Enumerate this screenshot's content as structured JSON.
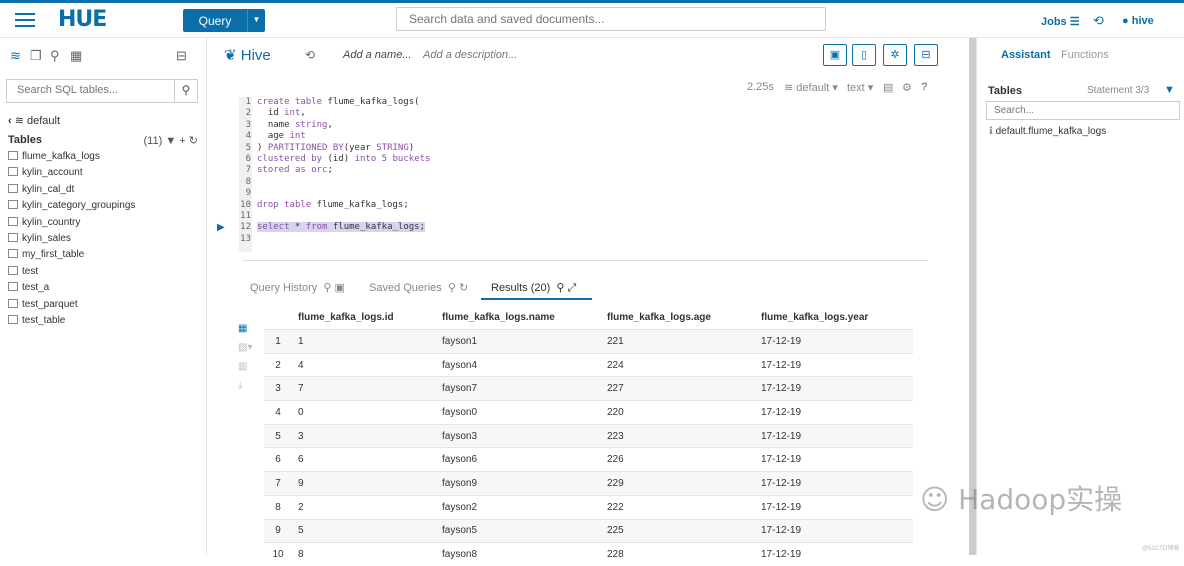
{
  "header": {
    "logo": "HUE",
    "query_button": "Query",
    "search_placeholder": "Search data and saved documents...",
    "jobs": "Jobs",
    "user": "hive"
  },
  "left": {
    "search_placeholder": "Search SQL tables...",
    "database": "default",
    "tables_label": "Tables",
    "tables_count": "(11)",
    "tables": [
      "flume_kafka_logs",
      "kylin_account",
      "kylin_cal_dt",
      "kylin_category_groupings",
      "kylin_country",
      "kylin_sales",
      "my_first_table",
      "test",
      "test_a",
      "test_parquet",
      "test_table"
    ]
  },
  "editor": {
    "type": "Hive",
    "add_name": "Add a name...",
    "add_description": "Add a description...",
    "elapsed": "2.25s",
    "database": "default",
    "format": "text",
    "code_lines": [
      {
        "n": "1",
        "t": "create table flume_kafka_logs("
      },
      {
        "n": "2",
        "t": "  id int,"
      },
      {
        "n": "3",
        "t": "  name string,"
      },
      {
        "n": "4",
        "t": "  age int"
      },
      {
        "n": "5",
        "t": ") PARTITIONED BY(year STRING)"
      },
      {
        "n": "6",
        "t": "clustered by (id) into 5 buckets"
      },
      {
        "n": "7",
        "t": "stored as orc;"
      },
      {
        "n": "8",
        "t": ""
      },
      {
        "n": "9",
        "t": ""
      },
      {
        "n": "10",
        "t": "drop table flume_kafka_logs;"
      },
      {
        "n": "11",
        "t": ""
      },
      {
        "n": "12",
        "t": "select * from flume_kafka_logs;"
      },
      {
        "n": "13",
        "t": ""
      }
    ]
  },
  "tabs": {
    "history": "Query History",
    "saved": "Saved Queries",
    "results": "Results (20)"
  },
  "results": {
    "columns": [
      "flume_kafka_logs.id",
      "flume_kafka_logs.name",
      "flume_kafka_logs.age",
      "flume_kafka_logs.year"
    ],
    "rows": [
      [
        "1",
        "1",
        "fayson1",
        "221",
        "17-12-19"
      ],
      [
        "2",
        "4",
        "fayson4",
        "224",
        "17-12-19"
      ],
      [
        "3",
        "7",
        "fayson7",
        "227",
        "17-12-19"
      ],
      [
        "4",
        "0",
        "fayson0",
        "220",
        "17-12-19"
      ],
      [
        "5",
        "3",
        "fayson3",
        "223",
        "17-12-19"
      ],
      [
        "6",
        "6",
        "fayson6",
        "226",
        "17-12-19"
      ],
      [
        "7",
        "9",
        "fayson9",
        "229",
        "17-12-19"
      ],
      [
        "8",
        "2",
        "fayson2",
        "222",
        "17-12-19"
      ],
      [
        "9",
        "5",
        "fayson5",
        "225",
        "17-12-19"
      ],
      [
        "10",
        "8",
        "fayson8",
        "228",
        "17-12-19"
      ]
    ]
  },
  "right": {
    "tab_assistant": "Assistant",
    "tab_functions": "Functions",
    "tables_label": "Tables",
    "statement": "Statement 3/3",
    "search_placeholder": "Search...",
    "info_item": "default.flume_kafka_logs"
  },
  "watermark": "Hadoop实操",
  "watermark_small": "@51CTO博客"
}
